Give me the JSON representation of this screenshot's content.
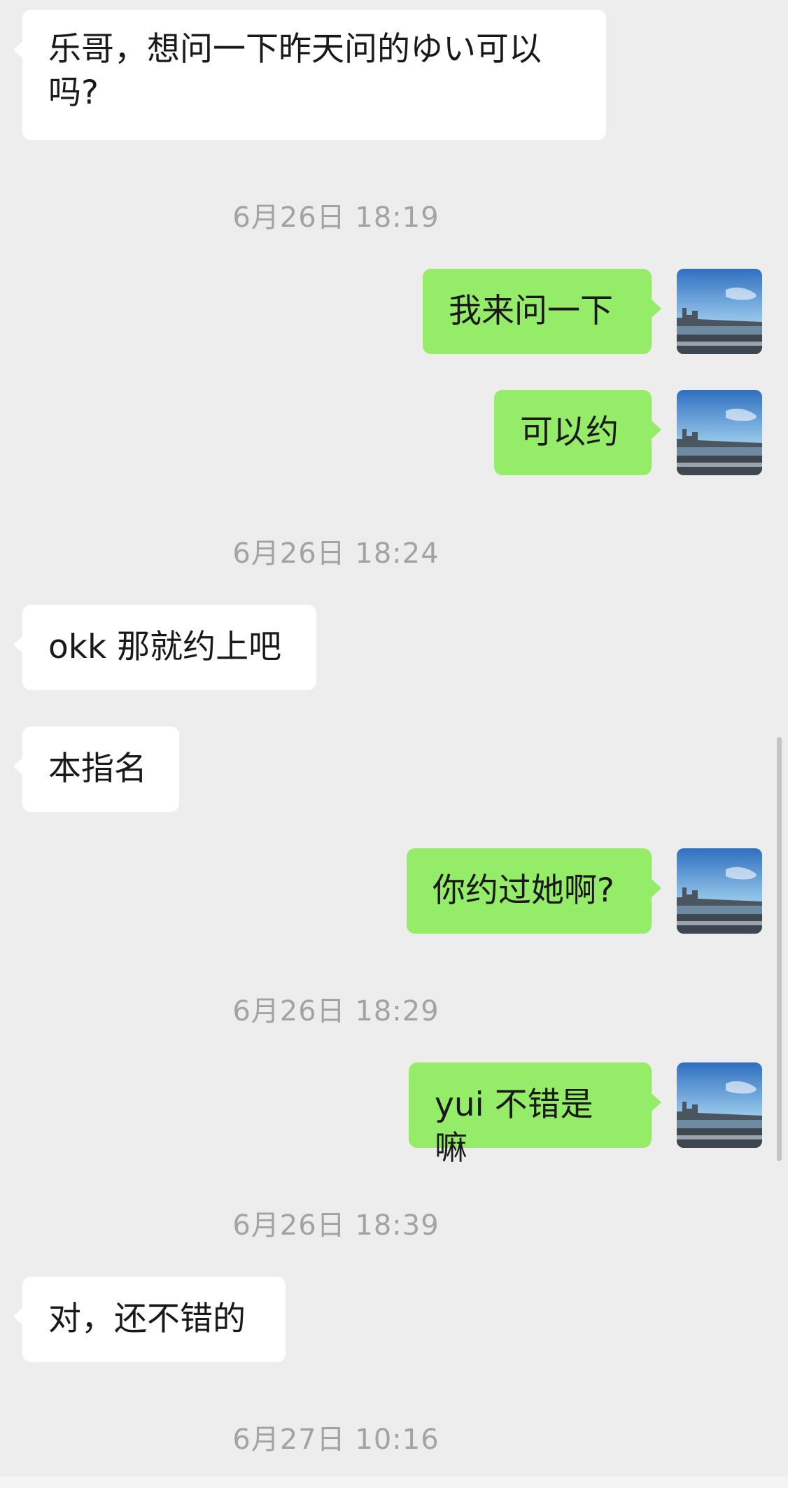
{
  "chat": {
    "messages": [
      {
        "type": "in",
        "text": "乐哥，想问一下昨天问的ゆい可以\n吗?"
      },
      {
        "type": "time",
        "text": "6月26日 18:19"
      },
      {
        "type": "out",
        "text": "我来问一下"
      },
      {
        "type": "out",
        "text": "可以约"
      },
      {
        "type": "time",
        "text": "6月26日 18:24"
      },
      {
        "type": "in",
        "text": "okk 那就约上吧"
      },
      {
        "type": "in",
        "text": "本指名"
      },
      {
        "type": "out",
        "text": "你约过她啊?"
      },
      {
        "type": "time",
        "text": "6月26日 18:29"
      },
      {
        "type": "out",
        "text": "yui 不错是嘛"
      },
      {
        "type": "time",
        "text": "6月26日 18:39"
      },
      {
        "type": "in",
        "text": "对，还不错的"
      },
      {
        "type": "time",
        "text": "6月27日 10:16"
      }
    ]
  },
  "colors": {
    "background": "#ededed",
    "incoming_bubble": "#ffffff",
    "outgoing_bubble": "#95ec69",
    "timestamp": "#a3a3a3"
  },
  "icons": {
    "self_avatar": "city-skyline-photo-avatar"
  }
}
